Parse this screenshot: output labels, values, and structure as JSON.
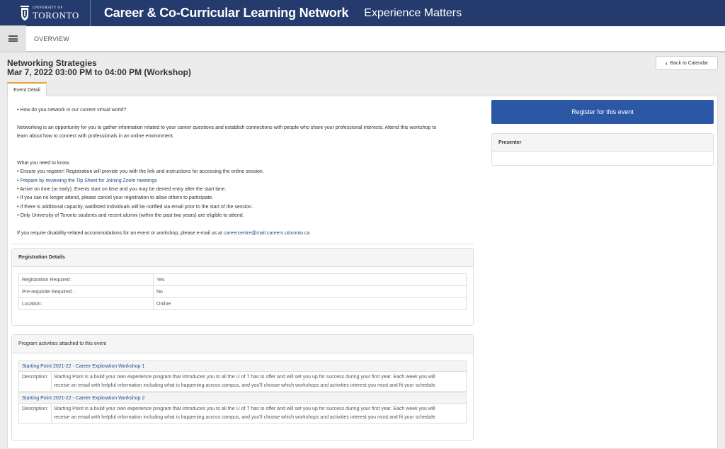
{
  "header": {
    "logo_university_line": "UNIVERSITY OF",
    "logo_name": "TORONTO",
    "title": "Career & Co-Curricular Learning Network",
    "tagline": "Experience Matters",
    "brand_color": "#253b6e"
  },
  "nav": {
    "menu_icon": "hamburger-menu-icon",
    "overview_label": "OVERVIEW"
  },
  "event": {
    "title": "Networking Strategies",
    "datetime": "Mar 7, 2022 03:00 PM to 04:00 PM (Workshop)",
    "back_label": "Back to Calendar",
    "tab_label": "Event Detail",
    "register_label": "Register for this event",
    "register_color": "#2b57a4",
    "presenter_label": "Presenter"
  },
  "description": {
    "bullet_question": "• How do you network in our current virtual world?",
    "intro_line1": "Networking is an opportunity for you to gather information related to your career questions and establish connections with people who share your professional interests. Attend this workshop to",
    "intro_line2": "learn about how to connect with professionals in an online environment.",
    "need_to_know": "What you need to know.",
    "items": [
      "• Ensure you register! Registration will provide you with the link and instructions for accessing the online session.",
      "• Prepare by reviewing the Tip Sheet for Joining Zoom meetings",
      "• Arrive on time (or early). Events start on time and you may be denied entry after the start time.",
      "• If you can no longer attend, please cancel your registration to allow others to participate.",
      "• If there is additional capacity, waitlisted individuals will be notified via email prior to the start of the session.",
      "• Only University of Toronto students and recent alumni (within the past two years) are eligible to attend."
    ],
    "tip_sheet_prefix": "• ",
    "tip_sheet_link": "Prepare by reviewing the Tip Sheet for Joining Zoom meetings",
    "accommodation_text": "If you require disability-related accommodations for an event or workshop, please e-mail us at ",
    "accommodation_email": "careercentre@mail.careers.utoronto.ca"
  },
  "registration": {
    "heading": "Registration Details",
    "rows": [
      {
        "label": "Registration Required :",
        "value": "Yes"
      },
      {
        "label": "Pre-requisite Required :",
        "value": "No"
      },
      {
        "label": "Location:",
        "value": "Online"
      }
    ]
  },
  "activities": {
    "heading": "Program activities attached to this event",
    "description_label": "Description:",
    "items": [
      {
        "title": "Starting Point 2021-22 - Career Exploration Workshop 1",
        "line1": "Starting Point is a build your own experience program that introduces you to all the U of T has to offer and will set you up for success during your first year. Each week you will",
        "line2": "receive an email with helpful information including what is happening across campus, and you'll choose which workshops and activities interest you most and fit your schedule."
      },
      {
        "title": "Starting Point 2021-22 - Career Exploration Workshop 2",
        "line1": "Starting Point is a build your own experience program that introduces you to all the U of T has to offer and will set you up for success during your first year. Each week you will",
        "line2": "receive an email with helpful information including what is happening across campus, and you'll choose which workshops and activities interest you most and fit your schedule."
      }
    ]
  }
}
